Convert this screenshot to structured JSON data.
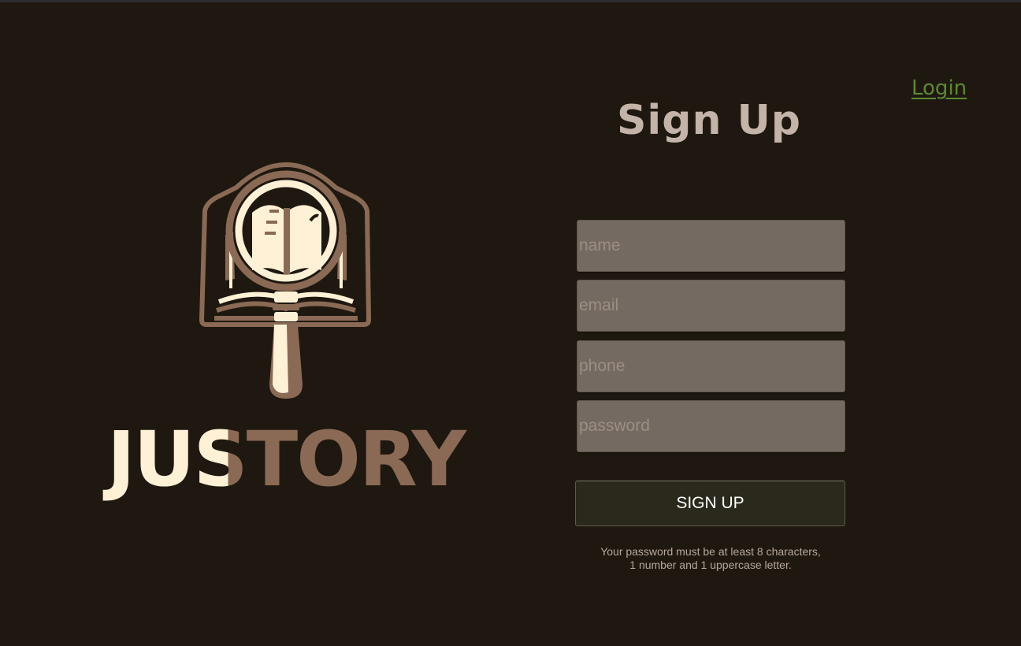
{
  "brand": {
    "logo_icon": "magnifying-glass-book-icon",
    "name": "JUSTORY"
  },
  "nav": {
    "login_label": "Login"
  },
  "form": {
    "title": "Sign Up",
    "fields": [
      {
        "name": "name",
        "placeholder": "name",
        "value": ""
      },
      {
        "name": "email",
        "placeholder": "email",
        "value": ""
      },
      {
        "name": "phone",
        "placeholder": "phone",
        "value": ""
      },
      {
        "name": "password",
        "placeholder": "password",
        "value": ""
      }
    ],
    "submit_label": "SIGN UP",
    "password_hint_line1": "Your password must be at least 8 characters,",
    "password_hint_line2": "1 number and 1 uppercase letter."
  },
  "colors": {
    "background": "#1f1810",
    "accent_cream": "#fff1d6",
    "accent_brown": "#8a6a55",
    "link_green": "#5b8a30",
    "input_bg": "#746a61",
    "button_bg": "#2a291b"
  }
}
